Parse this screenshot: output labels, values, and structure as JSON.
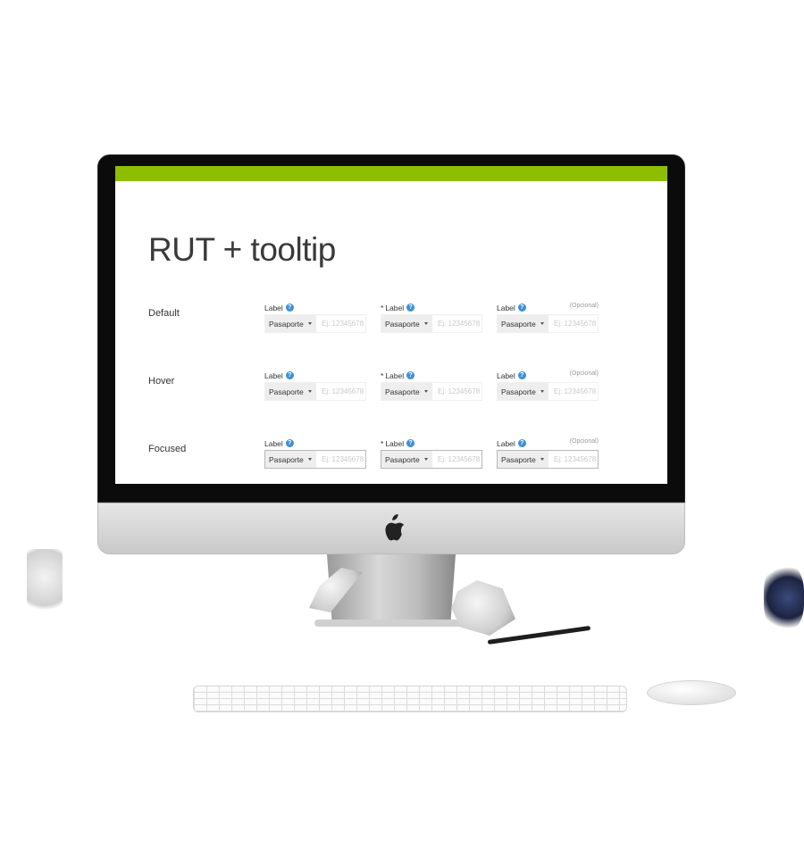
{
  "page": {
    "title": "RUT + tooltip"
  },
  "rows": [
    {
      "state": "Default",
      "fields": [
        {
          "label": "Label",
          "required": false,
          "optional": "",
          "select": "Pasaporte",
          "placeholder": "Ej: 12345678"
        },
        {
          "label": "Label",
          "required": true,
          "optional": "",
          "select": "Pasaporte",
          "placeholder": "Ej: 12345678"
        },
        {
          "label": "Label",
          "required": false,
          "optional": "(Opcional)",
          "select": "Pasaporte",
          "placeholder": "Ej: 12345678"
        }
      ]
    },
    {
      "state": "Hover",
      "fields": [
        {
          "label": "Label",
          "required": false,
          "optional": "",
          "select": "Pasaporte",
          "placeholder": "Ej: 12345678"
        },
        {
          "label": "Label",
          "required": true,
          "optional": "",
          "select": "Pasaporte",
          "placeholder": "Ej: 12345678"
        },
        {
          "label": "Label",
          "required": false,
          "optional": "(Opcional)",
          "select": "Pasaporte",
          "placeholder": "Ej: 12345678"
        }
      ]
    },
    {
      "state": "Focused",
      "fields": [
        {
          "label": "Label",
          "required": false,
          "optional": "",
          "select": "Pasaporte",
          "placeholder": "Ej: 12345678"
        },
        {
          "label": "Label",
          "required": true,
          "optional": "",
          "select": "Pasaporte",
          "placeholder": "Ej: 12345678"
        },
        {
          "label": "Label",
          "required": false,
          "optional": "(Opcional)",
          "select": "Pasaporte",
          "placeholder": "Ej: 12345678"
        }
      ]
    }
  ],
  "symbols": {
    "asterisk": "*",
    "help": "?"
  },
  "colors": {
    "accent_bar": "#8fbe00",
    "help_icon": "#3d8fd8"
  },
  "icons": {
    "help": "question-circle-icon",
    "caret": "caret-down-icon",
    "brand": "apple-logo-icon"
  }
}
